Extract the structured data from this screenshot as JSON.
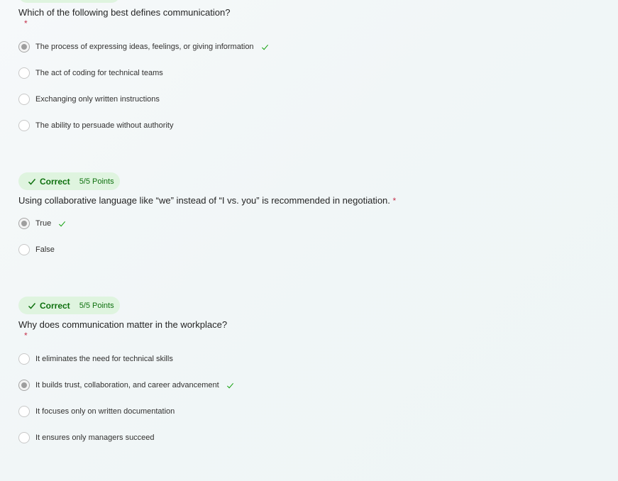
{
  "questions": [
    {
      "text": "Which of the following best defines communication?",
      "required_mark": "*",
      "options": [
        {
          "label": "The process of expressing ideas, feelings, or giving information",
          "selected": true,
          "correct": true
        },
        {
          "label": "The act of coding for technical teams",
          "selected": false,
          "correct": false
        },
        {
          "label": "Exchanging only written instructions",
          "selected": false,
          "correct": false
        },
        {
          "label": "The ability to persuade without authority",
          "selected": false,
          "correct": false
        }
      ]
    },
    {
      "badge": {
        "status": "Correct",
        "points": "5/5 Points"
      },
      "text": "Using collaborative language like “we” instead of “I vs. you” is recommended in negotiation.",
      "required_mark": "*",
      "options": [
        {
          "label": "True",
          "selected": true,
          "correct": true
        },
        {
          "label": "False",
          "selected": false,
          "correct": false
        }
      ]
    },
    {
      "badge": {
        "status": "Correct",
        "points": "5/5 Points"
      },
      "text": "Why does communication matter in the workplace?",
      "required_mark": "*",
      "options": [
        {
          "label": "It eliminates the need for technical skills",
          "selected": false,
          "correct": false
        },
        {
          "label": "It builds trust, collaboration, and career advancement",
          "selected": true,
          "correct": true
        },
        {
          "label": "It focuses only on written documentation",
          "selected": false,
          "correct": false
        },
        {
          "label": "It ensures only managers succeed",
          "selected": false,
          "correct": false
        }
      ]
    }
  ],
  "colors": {
    "badge_bg": "#dff4df",
    "badge_text": "#0e700e",
    "required": "#c4314b",
    "correct_check": "#0e700e"
  },
  "icons": {
    "badge_check": "checkmark-icon",
    "correct_check": "checkmark-icon"
  }
}
